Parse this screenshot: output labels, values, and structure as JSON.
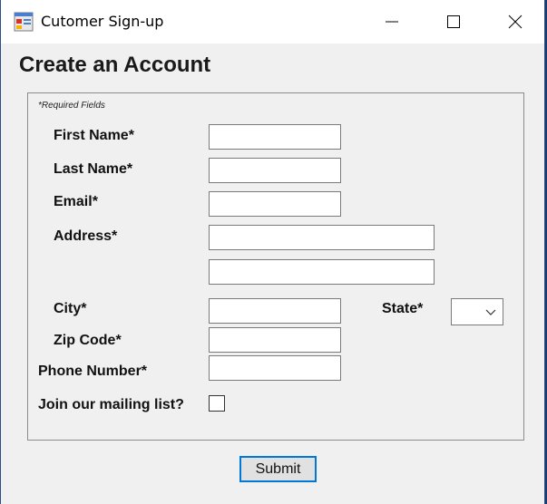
{
  "window": {
    "title": "Cutomer Sign-up",
    "controls": {
      "minimize": "minimize-icon",
      "maximize": "maximize-icon",
      "close": "close-icon"
    }
  },
  "form": {
    "heading": "Create an Account",
    "required_note": "*Required Fields",
    "labels": {
      "first_name": "First Name*",
      "last_name": "Last Name*",
      "email": "Email*",
      "address": "Address*",
      "city": "City*",
      "state": "State*",
      "zip": "Zip Code*",
      "phone": "Phone Number*",
      "mailing_list": "Join our mailing list?"
    },
    "values": {
      "first_name": "",
      "last_name": "",
      "email": "",
      "address_line1": "",
      "address_line2": "",
      "city": "",
      "state": "",
      "zip": "",
      "phone": ""
    },
    "mailing_list_checked": false,
    "submit_label": "Submit"
  },
  "colors": {
    "window_bg": "#f0f0f0",
    "titlebar_bg": "#ffffff",
    "focus_border": "#0078d7"
  }
}
